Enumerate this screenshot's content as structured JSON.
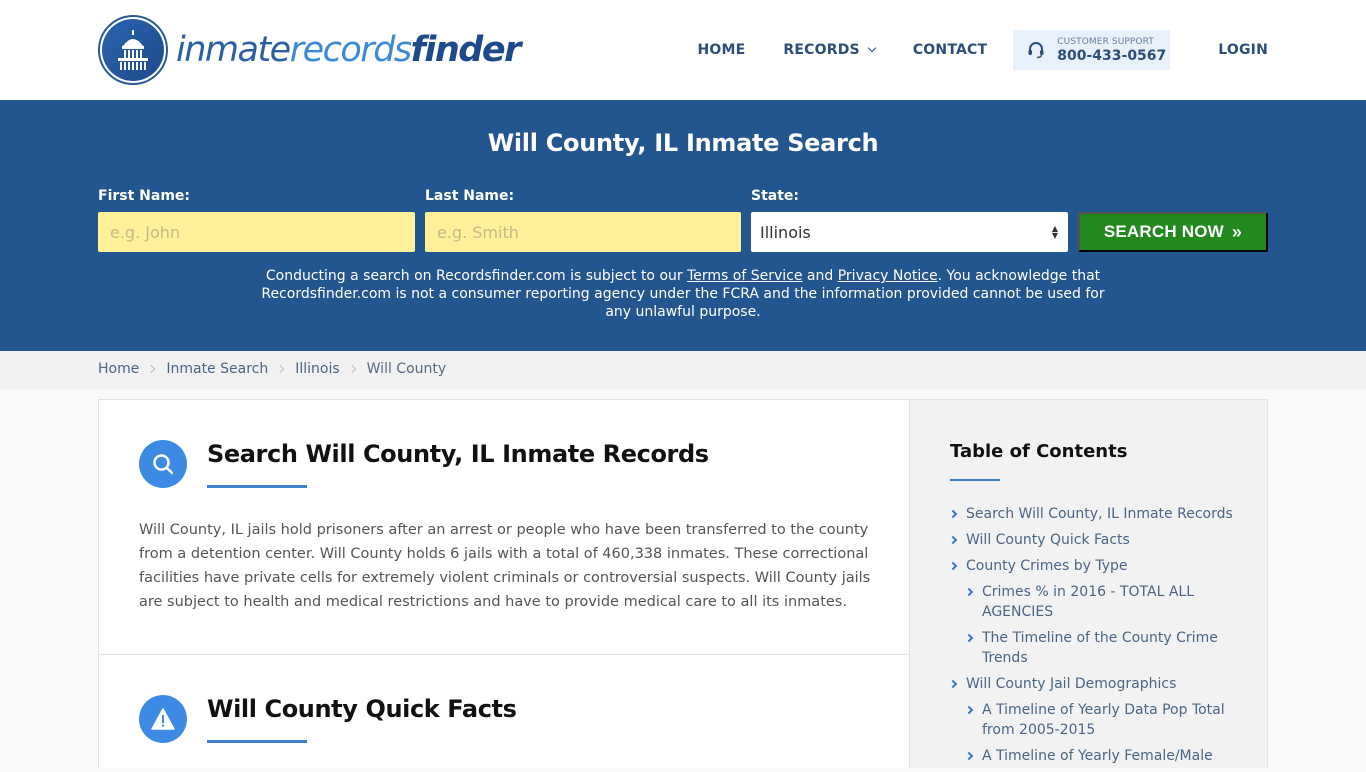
{
  "header": {
    "logo": {
      "part1": "inmate",
      "part2": "records",
      "part3": "finder"
    },
    "nav": [
      {
        "label": "HOME"
      },
      {
        "label": "RECORDS"
      },
      {
        "label": "CONTACT"
      }
    ],
    "support": {
      "label": "CUSTOMER SUPPORT",
      "phone": "800-433-0567"
    },
    "login": "LOGIN"
  },
  "hero": {
    "title": "Will County, IL Inmate Search",
    "first_name": {
      "label": "First Name:",
      "placeholder": "e.g. John",
      "value": ""
    },
    "last_name": {
      "label": "Last Name:",
      "placeholder": "e.g. Smith",
      "value": ""
    },
    "state": {
      "label": "State:",
      "selected": "Illinois"
    },
    "search_button": "SEARCH NOW",
    "disclaimer": {
      "part1": "Conducting a search on Recordsfinder.com is subject to our ",
      "terms_link": "Terms of Service",
      "part2": " and ",
      "privacy_link": "Privacy Notice",
      "part3": ". You acknowledge that Recordsfinder.com is not a consumer reporting agency under the FCRA and the information provided cannot be used for any unlawful purpose."
    }
  },
  "breadcrumb": [
    "Home",
    "Inmate Search",
    "Illinois",
    "Will County"
  ],
  "main": {
    "sections": [
      {
        "icon": "search-icon",
        "title": "Search Will County, IL Inmate Records",
        "body": "Will County, IL jails hold prisoners after an arrest or people who have been transferred to the county from a detention center. Will County holds 6 jails with a total of 460,338 inmates. These correctional facilities have private cells for extremely violent criminals or controversial suspects. Will County jails are subject to health and medical restrictions and have to provide medical care to all its inmates."
      },
      {
        "icon": "warning-icon",
        "title": "Will County Quick Facts"
      }
    ]
  },
  "sidebar": {
    "title": "Table of Contents",
    "items": [
      {
        "label": "Search Will County, IL Inmate Records",
        "level": 1
      },
      {
        "label": "Will County Quick Facts",
        "level": 1
      },
      {
        "label": "County Crimes by Type",
        "level": 1
      },
      {
        "label": "Crimes % in 2016 - TOTAL ALL AGENCIES",
        "level": 2
      },
      {
        "label": "The Timeline of the County Crime Trends",
        "level": 2
      },
      {
        "label": "Will County Jail Demographics",
        "level": 1
      },
      {
        "label": "A Timeline of Yearly Data Pop Total from 2005-2015",
        "level": 2
      },
      {
        "label": "A Timeline of Yearly Female/Male",
        "level": 2
      }
    ]
  },
  "colors": {
    "brand_blue": "#23558f",
    "accent_blue": "#3d8ae4",
    "search_green": "#23891f",
    "input_yellow": "#fff19a",
    "nav_text": "#2d4e78"
  }
}
